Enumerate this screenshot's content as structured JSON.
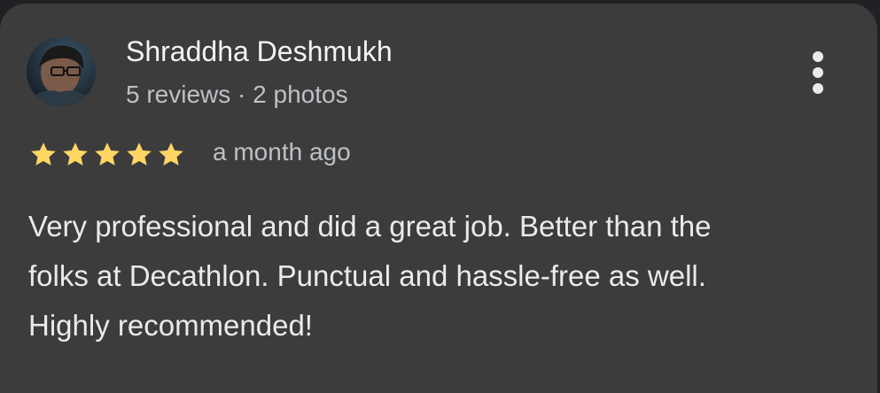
{
  "reviewer": {
    "name": "Shraddha Deshmukh",
    "meta": "5 reviews · 2 photos",
    "avatar_icon": "person-photo"
  },
  "menu": {
    "icon": "more-vertical-icon"
  },
  "rating": {
    "value": 5,
    "max": 5,
    "star_color": "#fdd663",
    "time_ago": "a month ago"
  },
  "review": {
    "lines": [
      "Very professional and did a great job. Better than the",
      "folks at Decathlon. Punctual and hassle-free as well.",
      "Highly recommended!"
    ]
  },
  "colors": {
    "card_background": "#3c3c3c",
    "primary_text": "#e8eaed",
    "secondary_text": "#bdc1c6"
  }
}
